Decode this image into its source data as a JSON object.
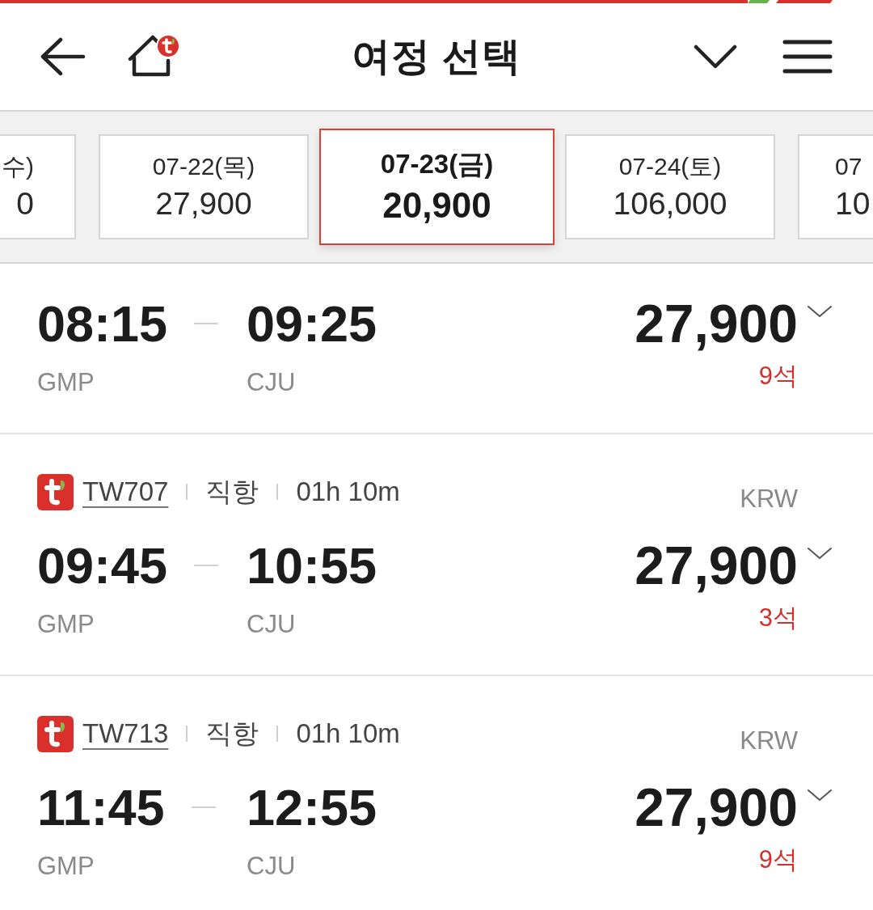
{
  "top_bar": {
    "title": "여정 선택"
  },
  "dates": [
    {
      "kind": "leading",
      "date": "수)",
      "price": "0",
      "selected": false
    },
    {
      "kind": "full",
      "date": "07-22(목)",
      "price": "27,900",
      "selected": false
    },
    {
      "kind": "full",
      "date": "07-23(금)",
      "price": "20,900",
      "selected": true
    },
    {
      "kind": "full",
      "date": "07-24(토)",
      "price": "106,000",
      "selected": false
    },
    {
      "kind": "trailing",
      "date": "07",
      "price": "10",
      "selected": false
    }
  ],
  "flights": [
    {
      "departure_time": "08:15",
      "arrival_time": "09:25",
      "departure_airport": "GMP",
      "arrival_airport": "CJU",
      "price": "27,900",
      "seats": "9석"
    },
    {
      "flight_no": "TW707",
      "flight_type": "직항",
      "duration": "01h 10m",
      "currency": "KRW",
      "departure_time": "09:45",
      "arrival_time": "10:55",
      "departure_airport": "GMP",
      "arrival_airport": "CJU",
      "price": "27,900",
      "seats": "3석"
    },
    {
      "flight_no": "TW713",
      "flight_type": "직항",
      "duration": "01h 10m",
      "currency": "KRW",
      "departure_time": "11:45",
      "arrival_time": "12:55",
      "departure_airport": "GMP",
      "arrival_airport": "CJU",
      "price": "27,900",
      "seats": "9석"
    }
  ]
}
